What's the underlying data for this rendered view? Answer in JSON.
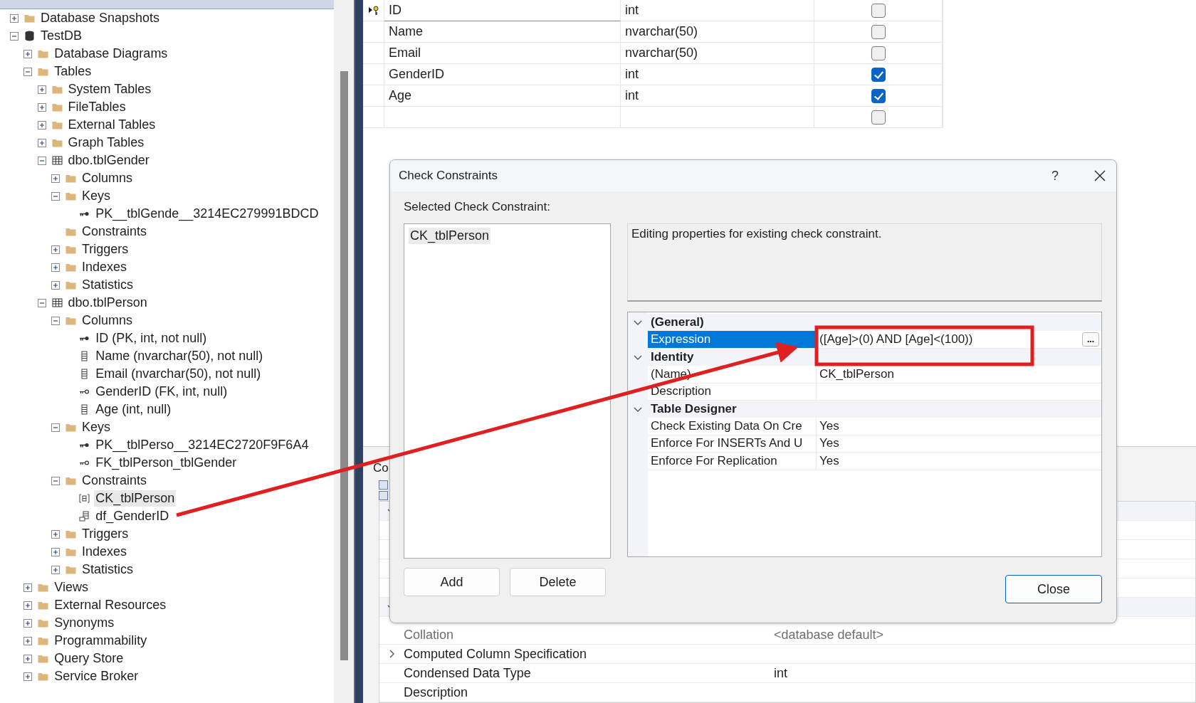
{
  "object_explorer": {
    "tree": [
      {
        "text": "Database Snapshots",
        "kind": "folder",
        "expanded": false,
        "selected": false
      },
      {
        "text": "TestDB",
        "kind": "database",
        "expanded": true,
        "selected": false,
        "children": [
          {
            "text": "Database Diagrams",
            "kind": "folder",
            "expanded": false,
            "selected": false
          },
          {
            "text": "Tables",
            "kind": "folder",
            "expanded": true,
            "selected": false,
            "children": [
              {
                "text": "System Tables",
                "kind": "folder",
                "expanded": false,
                "selected": false
              },
              {
                "text": "FileTables",
                "kind": "folder",
                "expanded": false,
                "selected": false
              },
              {
                "text": "External Tables",
                "kind": "folder",
                "expanded": false,
                "selected": false
              },
              {
                "text": "Graph Tables",
                "kind": "folder",
                "expanded": false,
                "selected": false
              },
              {
                "text": "dbo.tblGender",
                "kind": "table",
                "expanded": true,
                "selected": false,
                "children": [
                  {
                    "text": "Columns",
                    "kind": "folder",
                    "expanded": false,
                    "selected": false
                  },
                  {
                    "text": "Keys",
                    "kind": "folder",
                    "expanded": true,
                    "selected": false,
                    "children": [
                      {
                        "text": "PK__tblGende__3214EC279991BDCD",
                        "kind": "key",
                        "selected": false
                      }
                    ]
                  },
                  {
                    "text": "Constraints",
                    "kind": "folder",
                    "selected": false
                  },
                  {
                    "text": "Triggers",
                    "kind": "folder",
                    "expanded": false,
                    "selected": false
                  },
                  {
                    "text": "Indexes",
                    "kind": "folder",
                    "expanded": false,
                    "selected": false
                  },
                  {
                    "text": "Statistics",
                    "kind": "folder",
                    "expanded": false,
                    "selected": false
                  }
                ]
              },
              {
                "text": "dbo.tblPerson",
                "kind": "table",
                "expanded": true,
                "selected": false,
                "children": [
                  {
                    "text": "Columns",
                    "kind": "folder",
                    "expanded": true,
                    "selected": false,
                    "children": [
                      {
                        "text": "ID (PK, int, not null)",
                        "kind": "key",
                        "selected": false
                      },
                      {
                        "text": "Name (nvarchar(50), not null)",
                        "kind": "column",
                        "selected": false
                      },
                      {
                        "text": "Email (nvarchar(50), not null)",
                        "kind": "column",
                        "selected": false
                      },
                      {
                        "text": "GenderID (FK, int, null)",
                        "kind": "foreign",
                        "selected": false
                      },
                      {
                        "text": "Age (int, null)",
                        "kind": "column",
                        "selected": false
                      }
                    ]
                  },
                  {
                    "text": "Keys",
                    "kind": "folder",
                    "expanded": true,
                    "selected": false,
                    "children": [
                      {
                        "text": "PK__tblPerso__3214EC2720F9F6A4",
                        "kind": "key",
                        "selected": false
                      },
                      {
                        "text": "FK_tblPerson_tblGender",
                        "kind": "foreign",
                        "selected": false
                      }
                    ]
                  },
                  {
                    "text": "Constraints",
                    "kind": "folder",
                    "expanded": true,
                    "selected": false,
                    "children": [
                      {
                        "text": "CK_tblPerson",
                        "kind": "check",
                        "selected": true
                      },
                      {
                        "text": "df_GenderID",
                        "kind": "default",
                        "selected": false
                      }
                    ]
                  },
                  {
                    "text": "Triggers",
                    "kind": "folder",
                    "expanded": false,
                    "selected": false
                  },
                  {
                    "text": "Indexes",
                    "kind": "folder",
                    "expanded": false,
                    "selected": false
                  },
                  {
                    "text": "Statistics",
                    "kind": "folder",
                    "expanded": false,
                    "selected": false
                  }
                ]
              }
            ]
          },
          {
            "text": "Views",
            "kind": "folder",
            "expanded": false,
            "selected": false
          },
          {
            "text": "External Resources",
            "kind": "folder",
            "expanded": false,
            "selected": false
          },
          {
            "text": "Synonyms",
            "kind": "folder",
            "expanded": false,
            "selected": false
          },
          {
            "text": "Programmability",
            "kind": "folder",
            "expanded": false,
            "selected": false
          },
          {
            "text": "Query Store",
            "kind": "folder",
            "expanded": false,
            "selected": false
          },
          {
            "text": "Service Broker",
            "kind": "folder",
            "expanded": false,
            "selected": false
          }
        ]
      }
    ]
  },
  "table_designer": {
    "rows": [
      {
        "name": "ID",
        "type": "int",
        "allow_nulls": false,
        "selected": true
      },
      {
        "name": "Name",
        "type": "nvarchar(50)",
        "allow_nulls": false,
        "selected": false
      },
      {
        "name": "Email",
        "type": "nvarchar(50)",
        "allow_nulls": false,
        "selected": false
      },
      {
        "name": "GenderID",
        "type": "int",
        "allow_nulls": true,
        "selected": false
      },
      {
        "name": "Age",
        "type": "int",
        "allow_nulls": true,
        "selected": false
      },
      {
        "allow_nulls": false,
        "selected": false
      }
    ]
  },
  "column_properties": {
    "tab": "Co",
    "rows": [
      {
        "name": "Collation",
        "value": "<database default>",
        "disabled": true
      },
      {
        "name": "Computed Column Specification",
        "expanded": false,
        "disabled": false
      },
      {
        "name": "Condensed Data Type",
        "value": "int",
        "disabled": false
      },
      {
        "name": "Description",
        "disabled": false
      }
    ]
  },
  "dialog": {
    "title": "Check Constraints",
    "help": "?",
    "list_label": "Selected Check Constraint:",
    "list": [
      {
        "text": "CK_tblPerson",
        "selected": true
      }
    ],
    "description": "Editing properties for existing check constraint.",
    "properties": [
      {
        "category": "(General)",
        "expanded": true,
        "rows": [
          {
            "name": "Expression",
            "value": "([Age]>(0) AND [Age]<(100))",
            "selected": true,
            "button": "..."
          }
        ]
      },
      {
        "category": "Identity",
        "expanded": true,
        "rows": [
          {
            "name": "(Name)",
            "value": "CK_tblPerson",
            "selected": false
          },
          {
            "name": "Description",
            "selected": false
          }
        ]
      },
      {
        "category": "Table Designer",
        "expanded": true,
        "rows": [
          {
            "name": "Check Existing Data On Cre",
            "value": "Yes",
            "selected": false
          },
          {
            "name": "Enforce For INSERTs And U",
            "value": "Yes",
            "selected": false
          },
          {
            "name": "Enforce For Replication",
            "value": "Yes",
            "selected": false
          }
        ]
      }
    ],
    "buttons": [
      {
        "label": "Add",
        "default": false
      },
      {
        "label": "Delete",
        "default": false
      },
      {
        "label": "Close",
        "default": true
      }
    ]
  }
}
